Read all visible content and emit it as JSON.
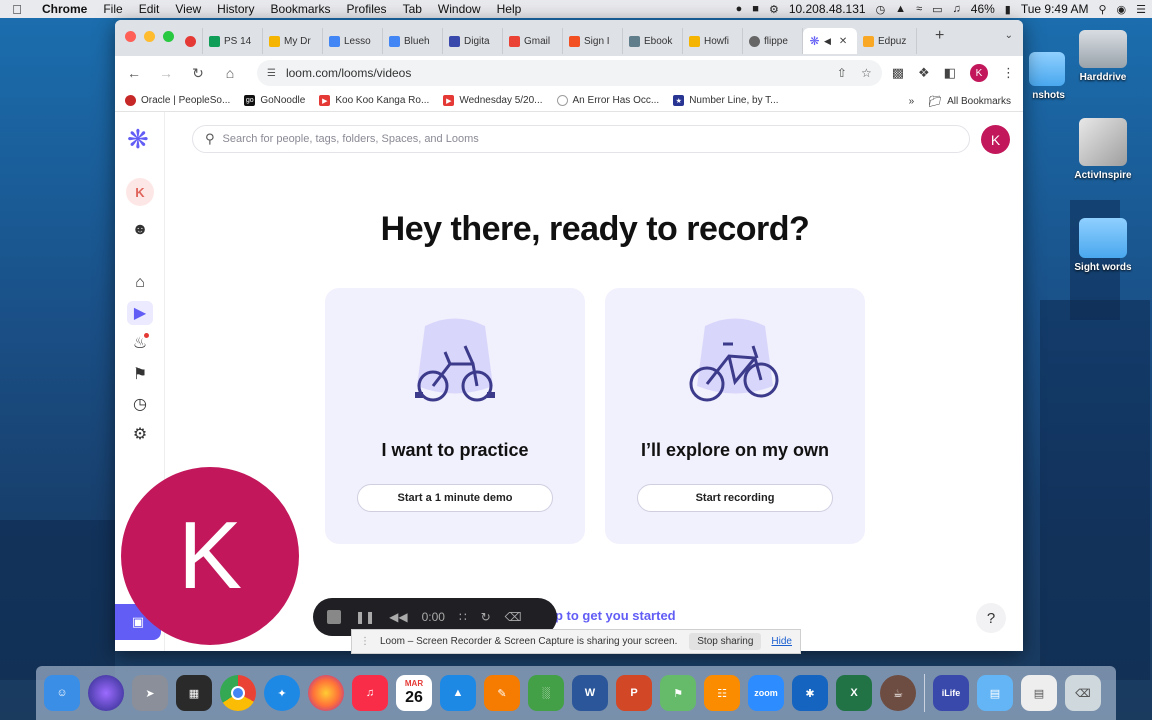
{
  "menubar": {
    "items": [
      "Chrome",
      "File",
      "Edit",
      "View",
      "History",
      "Bookmarks",
      "Profiles",
      "Tab",
      "Window",
      "Help"
    ],
    "ip": "10.208.48.131",
    "battery": "46%",
    "clock": "Tue 9:49 AM"
  },
  "desktop": {
    "icons": [
      {
        "label": "Harddrive"
      },
      {
        "label": "ActivInspire"
      },
      {
        "label": "Sight words"
      },
      {
        "label": "nshots"
      }
    ]
  },
  "browser": {
    "tabs": [
      {
        "label": "PS 14",
        "color": "#0f9d58"
      },
      {
        "label": "My Dr",
        "color": "#f4b400"
      },
      {
        "label": "Lesso",
        "color": "#4285f4"
      },
      {
        "label": "Blueh",
        "color": "#4285f4"
      },
      {
        "label": "Digita",
        "color": "#3949ab"
      },
      {
        "label": "Gmail",
        "color": "#ea4335"
      },
      {
        "label": "Sign I",
        "color": "#f25022"
      },
      {
        "label": "Ebook",
        "color": "#607d8b"
      },
      {
        "label": "Howfi",
        "color": "#f4b400"
      },
      {
        "label": "flippe",
        "color": "#666666"
      },
      {
        "label": "",
        "color": "#625df5",
        "active": true
      },
      {
        "label": "Edpuz",
        "color": "#f9a825"
      }
    ],
    "url": "loom.com/looms/videos",
    "profile_initial": "K",
    "bookmarks": [
      {
        "label": "Oracle | PeopleSo...",
        "color": "#c62828"
      },
      {
        "label": "GoNoodle",
        "color": "#111111"
      },
      {
        "label": "Koo Koo Kanga Ro...",
        "color": "#e53935"
      },
      {
        "label": "Wednesday 5/20...",
        "color": "#e53935"
      },
      {
        "label": "An Error Has Occ...",
        "color": "#9e9e9e"
      },
      {
        "label": "Number Line, by T...",
        "color": "#283593"
      }
    ],
    "all_bookmarks": "All Bookmarks"
  },
  "loom": {
    "search_placeholder": "Search for people, tags, folders, Spaces, and Looms",
    "avatar_initial": "K",
    "sidebar_initial": "K",
    "headline": "Hey there, ready to record?",
    "cards": [
      {
        "title": "I want to practice",
        "button": "Start a 1 minute demo"
      },
      {
        "title": "I’ll explore on my own",
        "button": "Start recording"
      }
    ],
    "bottom_hint": "p to get you started",
    "help": "?"
  },
  "recorder": {
    "camera_initial": "K",
    "timer": "0:00",
    "share_message": "Loom – Screen Recorder & Screen Capture is sharing your screen.",
    "stop_sharing": "Stop sharing",
    "hide": "Hide"
  },
  "dock": {
    "calendar_month": "MAR",
    "calendar_day": "26",
    "apps": [
      {
        "name": "finder",
        "color": "#3a8ee6"
      },
      {
        "name": "siri",
        "color": "#5b3fd6"
      },
      {
        "name": "launchpad",
        "color": "#8a8f99"
      },
      {
        "name": "mission-control",
        "color": "#2a2a2a"
      },
      {
        "name": "chrome",
        "color": "#34a853"
      },
      {
        "name": "safari",
        "color": "#1e88e5"
      },
      {
        "name": "firefox",
        "color": "#ff7139"
      },
      {
        "name": "music",
        "color": "#fa2d48"
      },
      {
        "name": "calendar",
        "color": "#ffffff"
      },
      {
        "name": "keynote",
        "color": "#1e88e5"
      },
      {
        "name": "pages",
        "color": "#f57c00"
      },
      {
        "name": "numbers",
        "color": "#43a047"
      },
      {
        "name": "word",
        "color": "#2b579a"
      },
      {
        "name": "powerpoint",
        "color": "#d24726"
      },
      {
        "name": "maps",
        "color": "#66bb6a"
      },
      {
        "name": "books",
        "color": "#fb8c00"
      },
      {
        "name": "zoom",
        "color": "#2d8cff"
      },
      {
        "name": "bluetooth",
        "color": "#1565c0"
      },
      {
        "name": "excel",
        "color": "#217346"
      },
      {
        "name": "coffee",
        "color": "#6d4c41"
      },
      {
        "name": "ilife",
        "color": "#3949ab"
      },
      {
        "name": "folder",
        "color": "#64b5f6"
      },
      {
        "name": "document",
        "color": "#eeeeee"
      },
      {
        "name": "trash",
        "color": "#cfd8dc"
      }
    ]
  }
}
